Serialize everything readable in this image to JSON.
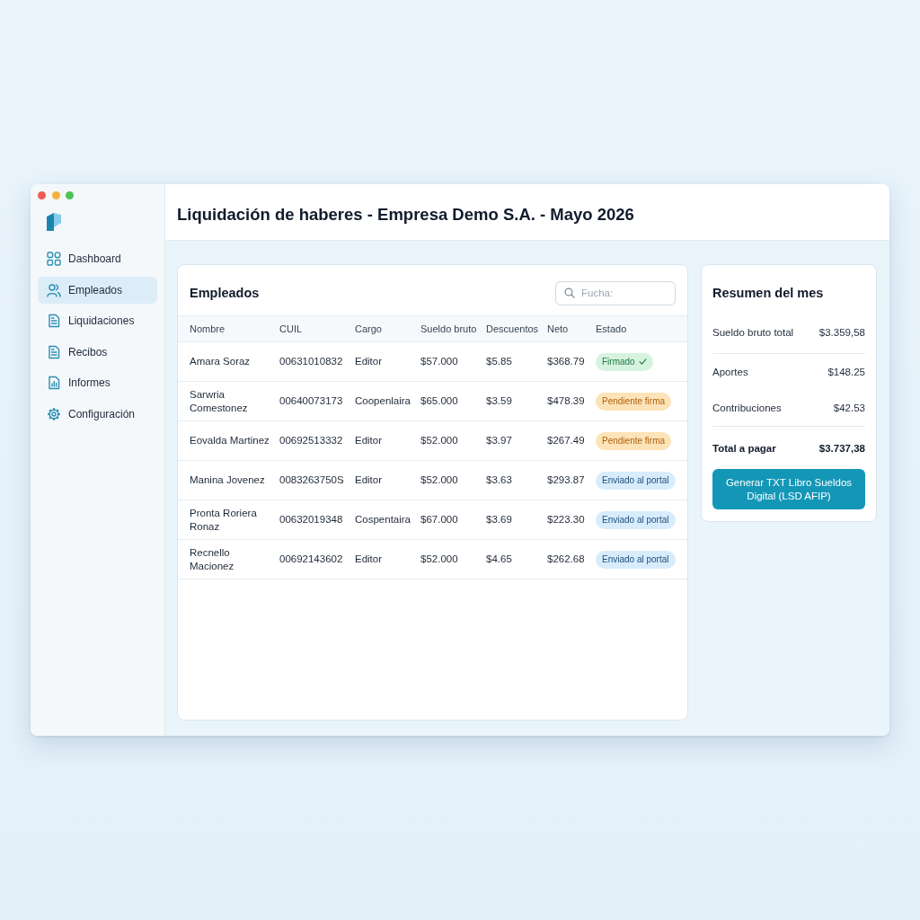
{
  "window": {
    "title": "Liquidación de haberes - Empresa Demo S.A. - Mayo 2026"
  },
  "sidebar": {
    "items": [
      {
        "label": "Dashboard",
        "selected": false
      },
      {
        "label": "Empleados",
        "selected": true
      },
      {
        "label": "Liquidaciones",
        "selected": false
      },
      {
        "label": "Recibos",
        "selected": false
      },
      {
        "label": "Informes",
        "selected": false
      },
      {
        "label": "Configuración",
        "selected": false
      }
    ]
  },
  "employees": {
    "title": "Empleados",
    "search": {
      "placeholder": "Fucha:"
    },
    "table": {
      "columns": [
        "Nombre",
        "CUIL",
        "Cargo",
        "Sueldo bruto",
        "Descuentos",
        "Neto",
        "Estado"
      ],
      "rows": [
        {
          "name": "Amara Soraz",
          "cuil": "00631010832",
          "cargo": "Editor",
          "sueldo_bruto": "$57.000",
          "descuentos": "$5.85",
          "neto": "$368.79",
          "estado": {
            "label": "Firmado",
            "kind": "signed"
          }
        },
        {
          "name": "Sarwria Comestonez",
          "cuil": "00640073173",
          "cargo": "Coopenlaira",
          "sueldo_bruto": "$65.000",
          "descuentos": "$3.59",
          "neto": "$478.39",
          "estado": {
            "label": "Pendiente firma",
            "kind": "pending"
          }
        },
        {
          "name": "Eovalda Martinez",
          "cuil": "00692513332",
          "cargo": "Editor",
          "sueldo_bruto": "$52.000",
          "descuentos": "$3.97",
          "neto": "$267.49",
          "estado": {
            "label": "Pendiente firma",
            "kind": "pending"
          }
        },
        {
          "name": "Manina Jovenez",
          "cuil": "0083263750S",
          "cargo": "Editor",
          "sueldo_bruto": "$52.000",
          "descuentos": "$3.63",
          "neto": "$293.87",
          "estado": {
            "label": "Enviado al portal",
            "kind": "sent"
          }
        },
        {
          "name": "Pronta Roriera Ronaz",
          "cuil": "00632019348",
          "cargo": "Cospentaira",
          "sueldo_bruto": "$67.000",
          "descuentos": "$3.69",
          "neto": "$223.30",
          "estado": {
            "label": "Enviado al portal",
            "kind": "sent"
          }
        },
        {
          "name": "Recnello Macionez",
          "cuil": "00692143602",
          "cargo": "Editor",
          "sueldo_bruto": "$52.000",
          "descuentos": "$4.65",
          "neto": "$262.68",
          "estado": {
            "label": "Enviado al portal",
            "kind": "sent"
          }
        }
      ]
    }
  },
  "summary": {
    "title": "Resumen del mes",
    "rows": [
      {
        "label": "Sueldo bruto total",
        "value": "$3.359,58",
        "kind": "subtotal"
      },
      {
        "label": "Aportes",
        "value": "$148.25",
        "kind": "item"
      },
      {
        "label": "Contribuciones",
        "value": "$42.53",
        "kind": "item"
      },
      {
        "label": "Total a pagar",
        "value": "$3.737,38",
        "kind": "total"
      }
    ],
    "button": "Generar TXT Libro Sueldos Digital (LSD AFIP)"
  }
}
